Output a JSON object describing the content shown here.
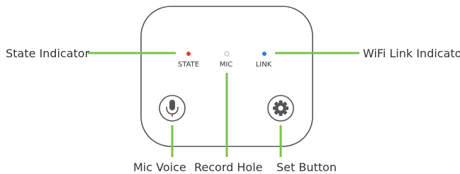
{
  "callouts": {
    "state_indicator": "State Indicator",
    "wifi_link_indicator": "WiFi Link Indicator",
    "mic_voice": "Mic Voice",
    "record_hole": "Record Hole",
    "set_button": "Set Button"
  },
  "indicators": {
    "state": "STATE",
    "mic": "MIC",
    "link": "LINK"
  },
  "icons": {
    "mic_button": "microphone-icon",
    "set_button": "gear-icon"
  },
  "colors": {
    "device_outline": "#555555",
    "leader_line": "#7cc14b",
    "state_led": "#e63a32",
    "mic_hole": "#bbbbbb",
    "link_led": "#2f7ed8",
    "text": "#333333"
  }
}
